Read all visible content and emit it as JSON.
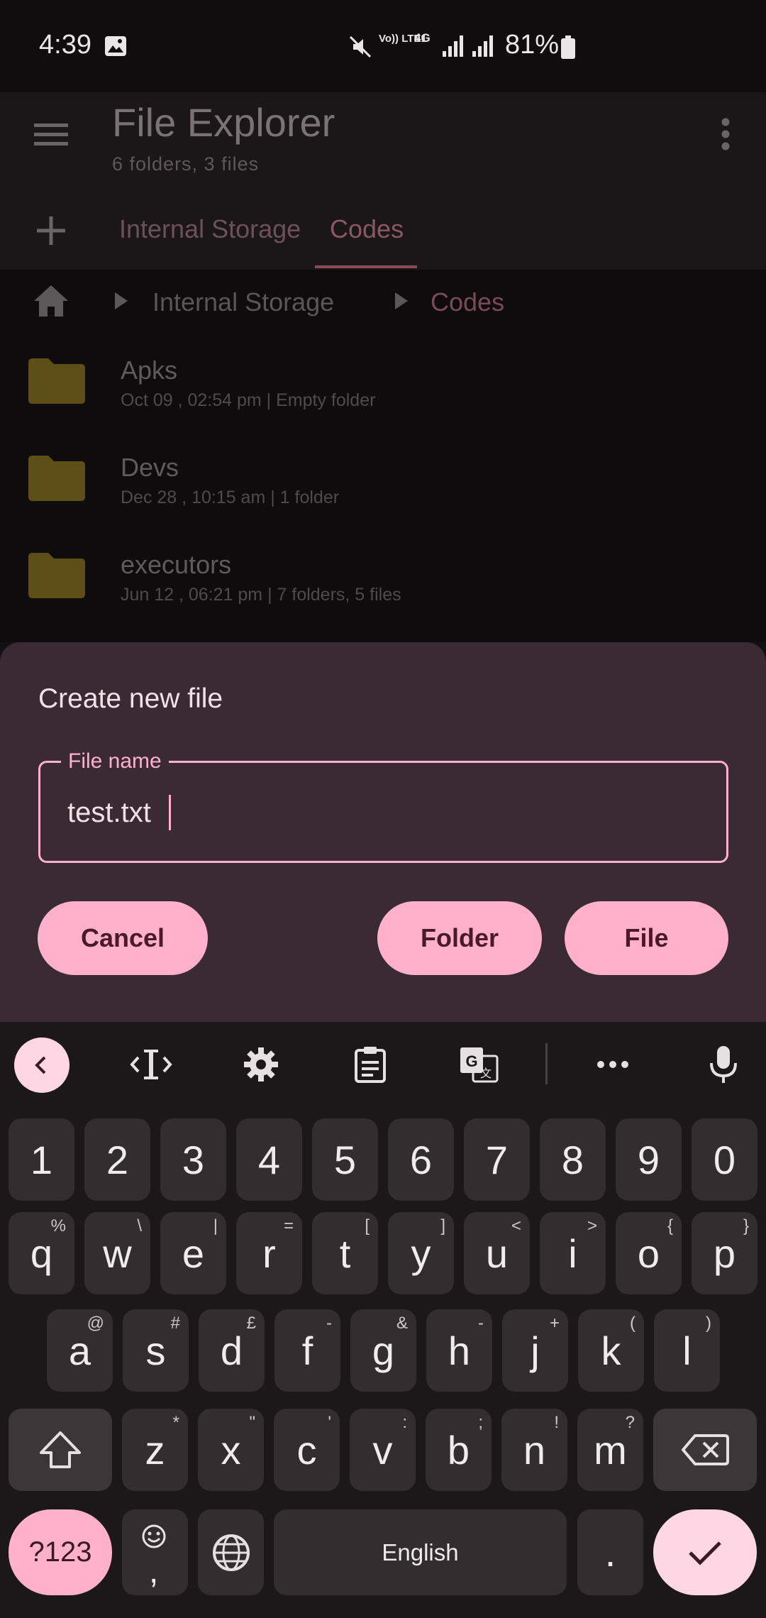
{
  "status_bar": {
    "time": "4:39",
    "battery_percent": "81%",
    "net_volte": "Vo)) LTE1",
    "net_4g": "4G"
  },
  "app_bar": {
    "title": "File Explorer",
    "subtitle": "6 folders, 3 files"
  },
  "tabs": [
    {
      "label": "Internal Storage",
      "selected": false
    },
    {
      "label": "Codes",
      "selected": true
    }
  ],
  "breadcrumb": [
    "Internal Storage",
    "Codes"
  ],
  "files": [
    {
      "name": "Apks",
      "meta": "Oct 09 , 02:54 pm  |  Empty folder"
    },
    {
      "name": "Devs",
      "meta": "Dec 28 , 10:15 am  |  1 folder"
    },
    {
      "name": "executors",
      "meta": "Jun 12 , 06:21 pm  |  7 folders, 5 files"
    }
  ],
  "dialog": {
    "title": "Create new file",
    "field_label": "File name",
    "field_value": "test.txt",
    "buttons": {
      "cancel": "Cancel",
      "folder": "Folder",
      "file": "File"
    }
  },
  "keyboard": {
    "numbers": [
      "1",
      "2",
      "3",
      "4",
      "5",
      "6",
      "7",
      "8",
      "9",
      "0"
    ],
    "row1": [
      [
        "q",
        "%"
      ],
      [
        "w",
        "\\"
      ],
      [
        "e",
        "|"
      ],
      [
        "r",
        "="
      ],
      [
        "t",
        "["
      ],
      [
        "y",
        "]"
      ],
      [
        "u",
        "<"
      ],
      [
        "i",
        ">"
      ],
      [
        "o",
        "{"
      ],
      [
        "p",
        "}"
      ]
    ],
    "row2": [
      [
        "a",
        "@"
      ],
      [
        "s",
        "#"
      ],
      [
        "d",
        "£"
      ],
      [
        "f",
        "-"
      ],
      [
        "g",
        "&"
      ],
      [
        "h",
        "-"
      ],
      [
        "j",
        "+"
      ],
      [
        "k",
        "("
      ],
      [
        "l",
        ")"
      ]
    ],
    "row3": [
      [
        "z",
        "*"
      ],
      [
        "x",
        "\""
      ],
      [
        "c",
        "'"
      ],
      [
        "v",
        ":"
      ],
      [
        "b",
        ";"
      ],
      [
        "n",
        "!"
      ],
      [
        "m",
        "?"
      ]
    ],
    "symbols_label": "?123",
    "comma_label": ",",
    "space_label": "English",
    "period_label": "."
  },
  "colors": {
    "accent": "#ffb0cb",
    "dialog_bg": "#3a2a31",
    "folder": "#6b5a1c"
  }
}
